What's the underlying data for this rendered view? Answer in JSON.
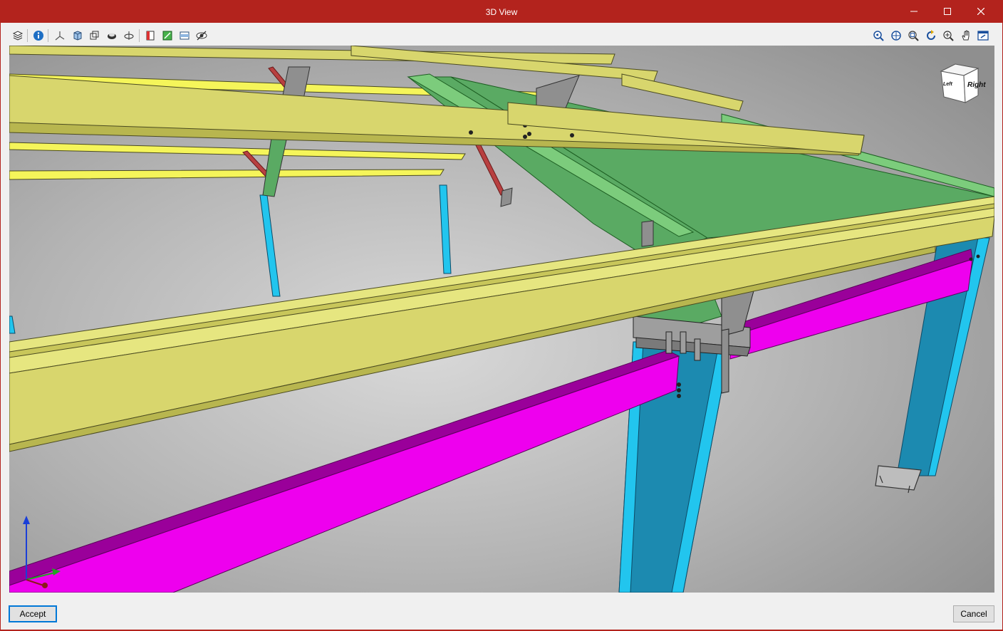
{
  "window": {
    "title": "3D View",
    "controls": [
      "minimize",
      "maximize",
      "close"
    ],
    "accent_color": "#b3231d"
  },
  "toolbar": {
    "left_tools": [
      {
        "name": "layers-icon"
      },
      {
        "name": "info-icon"
      },
      {
        "name": "axes-icon"
      },
      {
        "name": "solid-view-icon"
      },
      {
        "name": "wireframe-view-icon"
      },
      {
        "name": "shaded-view-icon"
      },
      {
        "name": "orbit-icon"
      },
      {
        "name": "section-icon"
      },
      {
        "name": "clip-box-icon"
      },
      {
        "name": "plane-icon"
      },
      {
        "name": "visibility-icon"
      }
    ],
    "right_tools": [
      {
        "name": "zoom-previous-icon"
      },
      {
        "name": "zoom-all-icon"
      },
      {
        "name": "zoom-window-icon"
      },
      {
        "name": "rotate-icon"
      },
      {
        "name": "zoom-icon"
      },
      {
        "name": "pan-icon"
      },
      {
        "name": "view-options-icon"
      }
    ]
  },
  "viewport": {
    "background": "#a9a9a9",
    "nav_cube": {
      "face_label": "Right",
      "side_label": "Left"
    },
    "member_colors": {
      "purlin": "#d8d66d",
      "rafter": "#5aaa63",
      "column": "#1c8ab0",
      "column_flange": "#22c5ee",
      "beam": "#ee00ee",
      "beam_top": "#9a009a",
      "brace": "#b84040",
      "plate": "#8f8f8f"
    }
  },
  "footer": {
    "accept_label": "Accept",
    "cancel_label": "Cancel"
  }
}
